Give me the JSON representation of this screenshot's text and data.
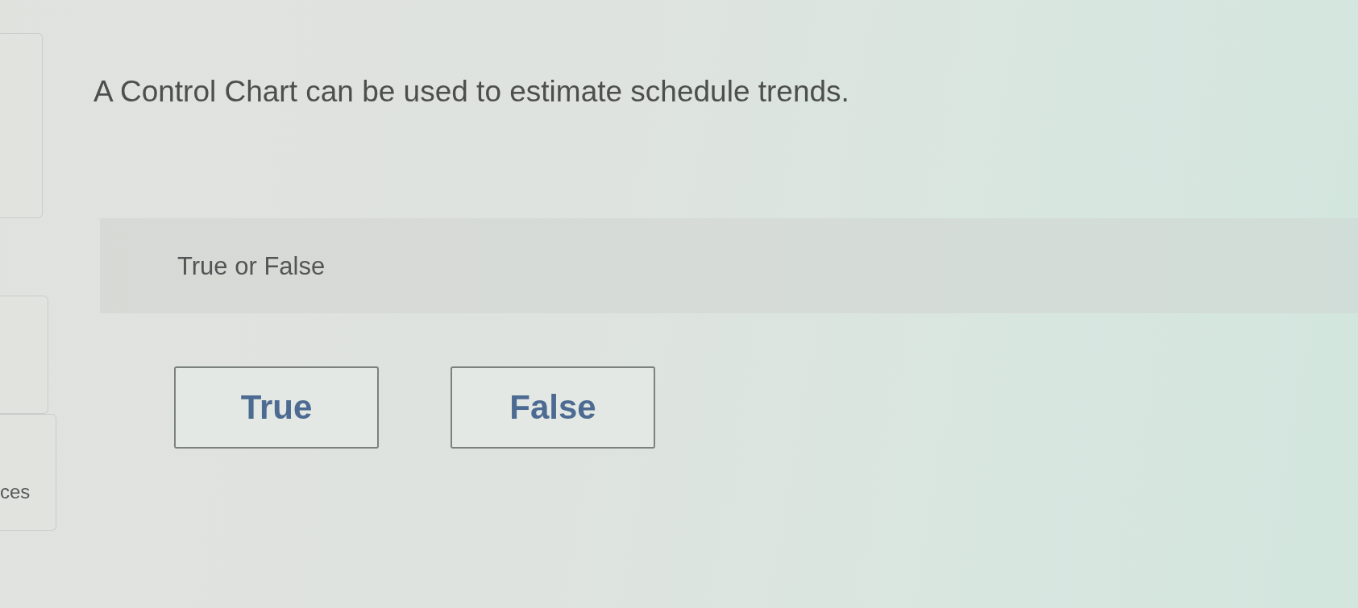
{
  "sidebar": {
    "label": "ces"
  },
  "question": {
    "text": "A Control Chart can be used to estimate schedule trends.",
    "prompt": "True or False"
  },
  "answers": [
    {
      "label": "True",
      "selected": false
    },
    {
      "label": "False",
      "selected": false
    }
  ]
}
